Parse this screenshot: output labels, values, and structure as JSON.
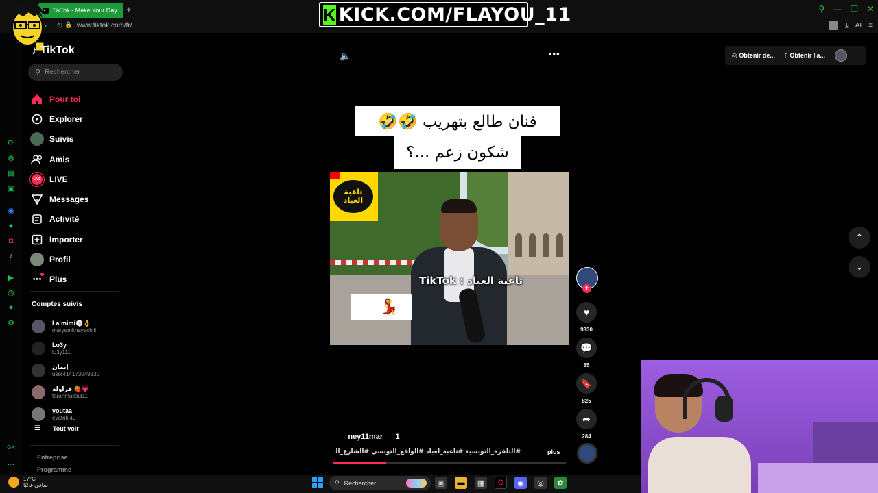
{
  "browser": {
    "tab_title": "TikTok - Make Your Day",
    "new_tab": "+",
    "url": "www.tiktok.com/fr/",
    "ai_label": "AI"
  },
  "overlay": {
    "kick_logo": "K",
    "kick_text": "KICK.COM/FLAYOU_11"
  },
  "sidebar": {
    "brand": "TikTok",
    "search_placeholder": "Rechercher",
    "nav": [
      {
        "label": "Pour toi",
        "icon": "home-icon"
      },
      {
        "label": "Explorer",
        "icon": "compass-icon"
      },
      {
        "label": "Suivis",
        "icon": "following-avatar"
      },
      {
        "label": "Amis",
        "icon": "friends-icon"
      },
      {
        "label": "LIVE",
        "icon": "live-icon"
      },
      {
        "label": "Messages",
        "icon": "messages-icon"
      },
      {
        "label": "Activité",
        "icon": "activity-icon"
      },
      {
        "label": "Importer",
        "icon": "upload-icon"
      },
      {
        "label": "Profil",
        "icon": "profile-avatar"
      },
      {
        "label": "Plus",
        "icon": "more-icon"
      }
    ],
    "following_header": "Comptes suivis",
    "following": [
      {
        "name": "La mimi🍥👌",
        "handle": "maryemkhayechiii"
      },
      {
        "name": "Lo3y",
        "handle": "lo3y111"
      },
      {
        "name": "إيمان",
        "handle": "user414173049330"
      },
      {
        "name": "فراولة 🍓💗",
        "handle": "farahmalloul11"
      },
      {
        "name": "youtaa",
        "handle": "eyatriki40"
      }
    ],
    "see_all": "Tout voir",
    "footer1": "Entreprise",
    "footer2": "Programme"
  },
  "top_right": {
    "btn1": "Obtenir de...",
    "btn2": "Obtenir l'a..."
  },
  "video": {
    "caption_line1": "فنان طالع بتهريب 🤣🤣",
    "caption_line2": "شكون زعم ...؟",
    "logo_text": "تاعبة العباد",
    "watermark": "TikTok : تاعبة العباد",
    "emojis": "😱💃",
    "author": "___ney11mar___1",
    "description": "#التلفزة_التونسية #تاعبة_لعباد #الواقع_التونسي #الشارع_التونسي ...",
    "more_label": "plus",
    "progress": 0.23
  },
  "actions": {
    "likes": "9330",
    "comments": "85",
    "saves": "825",
    "shares": "284"
  },
  "taskbar": {
    "temp": "17°C",
    "weather_desc": "صافي غالبًا",
    "search": "Rechercher"
  }
}
